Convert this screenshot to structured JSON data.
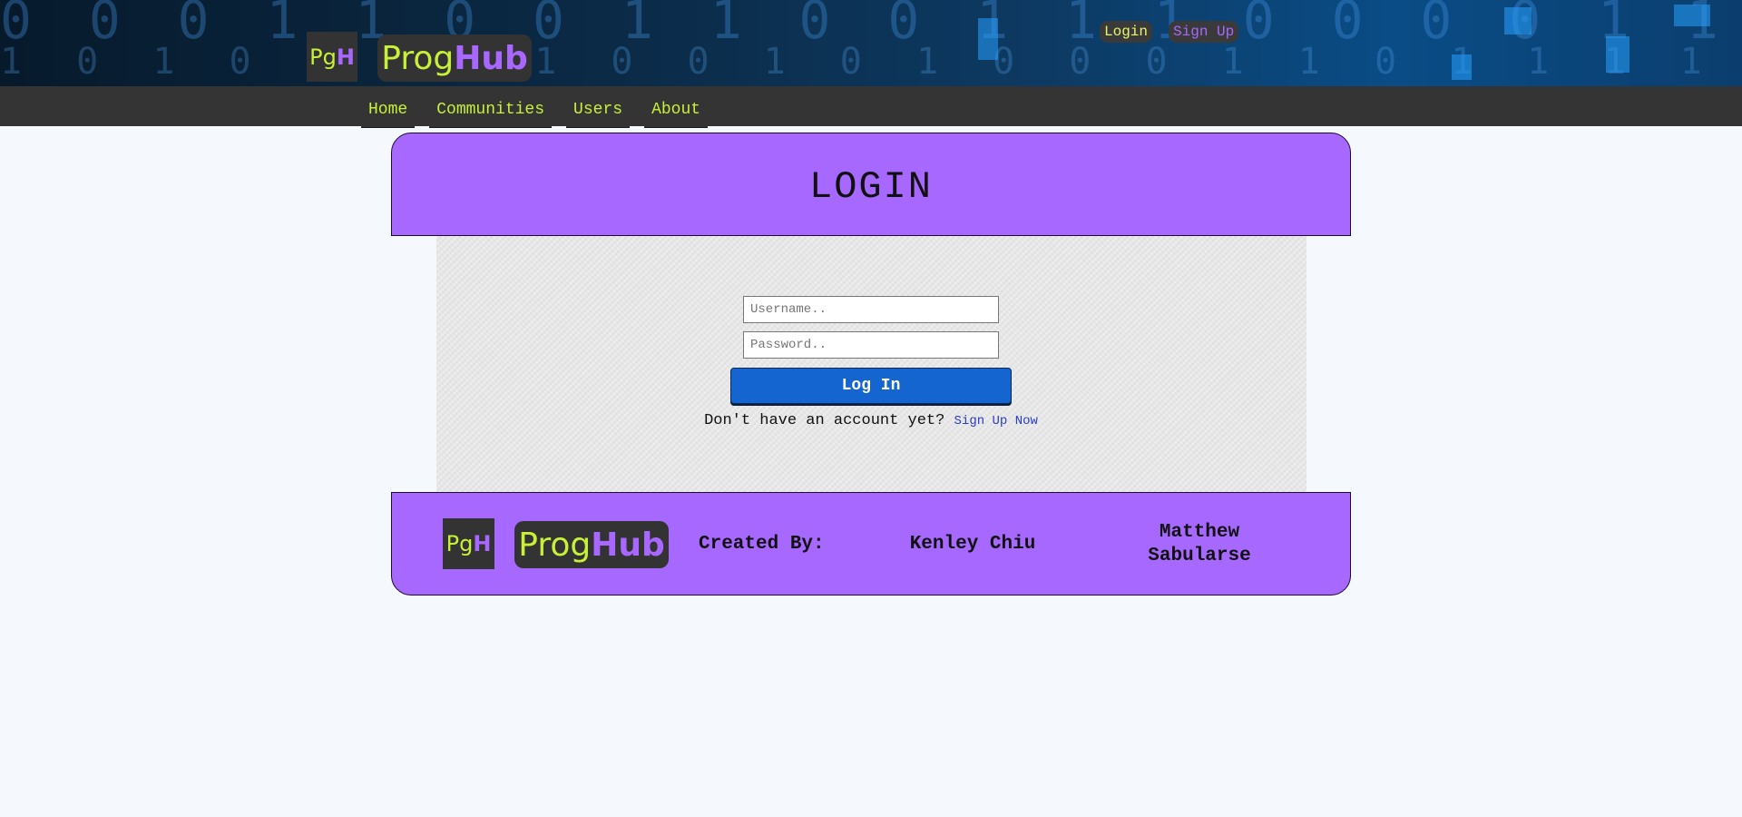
{
  "header": {
    "logo_small": {
      "part1": "Pg",
      "part2": "H"
    },
    "logo_big": {
      "part1": "Prog",
      "part2": "Hub"
    },
    "auth": {
      "login_label": "Login",
      "signup_label": "Sign Up"
    }
  },
  "nav": {
    "items": [
      {
        "label": "Home"
      },
      {
        "label": "Communities"
      },
      {
        "label": "Users"
      },
      {
        "label": "About"
      }
    ]
  },
  "main": {
    "title": "LOGIN",
    "username": {
      "value": "",
      "placeholder": "Username.."
    },
    "password": {
      "value": "",
      "placeholder": "Password.."
    },
    "login_button_label": "Log In",
    "signup_prompt": "Don't have an account yet?",
    "signup_link_label": "Sign Up Now"
  },
  "footer": {
    "logo_small": {
      "part1": "Pg",
      "part2": "H"
    },
    "logo_big": {
      "part1": "Prog",
      "part2": "Hub"
    },
    "created_by_label": "Created By:",
    "authors": [
      "Kenley Chiu",
      "Matthew Sabularse"
    ]
  },
  "colors": {
    "accent_purple": "#a768ff",
    "lime": "#c7f037",
    "nav_bg": "#343434",
    "button_blue": "#1565d0",
    "link_blue": "#2b3cc7",
    "page_bg": "#f5f8fc"
  }
}
